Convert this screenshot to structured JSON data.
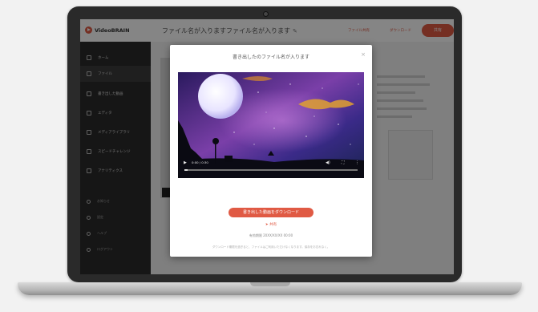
{
  "app": {
    "logo": "VideoBRAIN",
    "file_title": "ファイル名が入りますファイル名が入ります",
    "header_links": [
      "ファイル共有",
      "ダウンロード"
    ],
    "header_button": "共有"
  },
  "sidebar": {
    "items": [
      "ホーム",
      "ファイル",
      "書き出した動画",
      "エディタ",
      "メディアライブラリ",
      "スピードチャレンジ",
      "アナリティクス"
    ],
    "footer_items": [
      "お知らせ",
      "設定",
      "ヘルプ",
      "ログアウト"
    ]
  },
  "modal": {
    "title": "書き出したのファイル名が入ります",
    "close": "×",
    "download_button": "書き出した動画をダウンロード",
    "share_link": "共有",
    "expire": "有効期限 20XX/XX/XX 00:00",
    "note": "ダウンロード期限を過ぎると、ファイルはご利用いただけなくなります。保存をお忘れなく。"
  },
  "player": {
    "time": "0:00 / 0:30",
    "progress": 0.02
  },
  "icons": {
    "play": "play-icon",
    "volume": "volume-icon",
    "fullscreen": "fullscreen-icon",
    "more": "more-icon",
    "edit": "pencil-icon"
  },
  "colors": {
    "accent": "#e05a44",
    "sidebar": "#2b2b2b"
  }
}
